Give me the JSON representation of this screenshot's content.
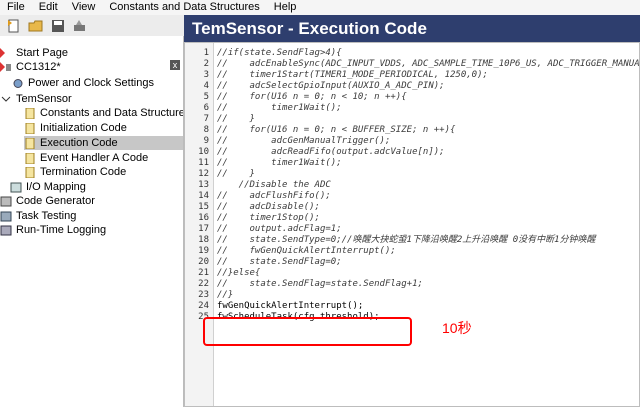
{
  "menubar": {
    "items": [
      "File",
      "Edit",
      "View",
      "Constants and Data Structures",
      "Help"
    ]
  },
  "toolbar": {
    "buttons": [
      "new-file-icon",
      "open-folder-icon",
      "save-icon",
      "build-icon"
    ]
  },
  "tree": {
    "items": [
      {
        "label": "Start Page",
        "icon": "start-page-icon"
      },
      {
        "label": "CC1312*",
        "icon": "project-icon"
      },
      {
        "label": "Power and Clock Settings",
        "icon": "settings-icon"
      },
      {
        "label": "TemSensor",
        "icon": "task-folder-icon"
      },
      {
        "label": "Constants and Data Structures",
        "icon": "document-icon"
      },
      {
        "label": "Initialization Code",
        "icon": "document-icon"
      },
      {
        "label": "Execution Code",
        "icon": "document-icon"
      },
      {
        "label": "Event Handler A Code",
        "icon": "document-icon"
      },
      {
        "label": "Termination Code",
        "icon": "document-icon"
      },
      {
        "label": "I/O Mapping",
        "icon": "io-mapping-icon"
      },
      {
        "label": "Code Generator",
        "icon": "code-generator-icon"
      },
      {
        "label": "Task Testing",
        "icon": "task-testing-icon"
      },
      {
        "label": "Run-Time Logging",
        "icon": "runtime-logging-icon"
      }
    ],
    "close_label": "x"
  },
  "editor": {
    "title": "TemSensor - Execution Code",
    "line_numbers": [
      "1",
      "2",
      "3",
      "4",
      "5",
      "6",
      "7",
      "8",
      "9",
      "10",
      "11",
      "12",
      "13",
      "14",
      "15",
      "16",
      "17",
      "18",
      "19",
      "20",
      "21",
      "22",
      "23",
      "24",
      "25"
    ],
    "lines": [
      {
        "text": "//if(state.SendFlag>4){",
        "style": "cmt"
      },
      {
        "text": "//    adcEnableSync(ADC_INPUT_VDDS, ADC_SAMPLE_TIME_10P6_US, ADC_TRIGGER_MANUAL);",
        "style": "cmt"
      },
      {
        "text": "//    timer1Start(TIMER1_MODE_PERIODICAL, 1250,0);",
        "style": "cmt"
      },
      {
        "text": "//    adcSelectGpioInput(AUXIO_A_ADC_PIN);",
        "style": "cmt"
      },
      {
        "text": "//    for(U16 n = 0; n < 10; n ++){",
        "style": "cmt"
      },
      {
        "text": "//        timer1Wait();",
        "style": "cmt"
      },
      {
        "text": "//    }",
        "style": "cmt"
      },
      {
        "text": "//    for(U16 n = 0; n < BUFFER_SIZE; n ++){",
        "style": "cmt"
      },
      {
        "text": "//        adcGenManualTrigger();",
        "style": "cmt"
      },
      {
        "text": "//        adcReadFifo(output.adcValue[n]);",
        "style": "cmt"
      },
      {
        "text": "//        timer1Wait();",
        "style": "cmt"
      },
      {
        "text": "//    }",
        "style": "cmt"
      },
      {
        "text": "    //Disable the ADC",
        "style": "cmt"
      },
      {
        "text": "//    adcFlushFifo();",
        "style": "cmt"
      },
      {
        "text": "//    adcDisable();",
        "style": "cmt"
      },
      {
        "text": "//    timer1Stop();",
        "style": "cmt"
      },
      {
        "text": "//    output.adcFlag=1;",
        "style": "cmt"
      },
      {
        "text": "//    state.SendType=0;//唤醒大抉蛇蛩1下降沿唤醒2上升沿唤醒 0没有中断1分钟唤醒",
        "style": "cmt"
      },
      {
        "text": "//    fwGenQuickAlertInterrupt();",
        "style": "cmt"
      },
      {
        "text": "//    state.SendFlag=0;",
        "style": "cmt"
      },
      {
        "text": "//}else{",
        "style": "cmt"
      },
      {
        "text": "//    state.SendFlag=state.SendFlag+1;",
        "style": "cmt"
      },
      {
        "text": "//}",
        "style": "cmt"
      },
      {
        "text": "fwGenQuickAlertInterrupt();",
        "style": "code"
      },
      {
        "text": "fwScheduleTask(cfg.threshold);",
        "style": "code"
      }
    ]
  },
  "annotation": {
    "text": "10秒",
    "color": "#ff0000"
  },
  "colors": {
    "header_bg": "#2e3e6e",
    "selected_bg": "#c7c7c7"
  }
}
